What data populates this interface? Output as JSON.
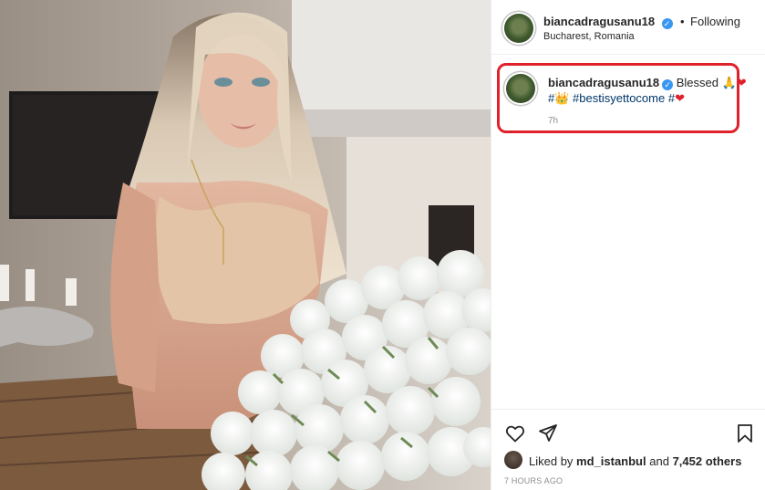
{
  "post": {
    "username": "biancadragusanu18",
    "follow_separator": "•",
    "follow_state": "Following",
    "location": "Bucharest, Romania"
  },
  "caption": {
    "username": "biancadragusanu18",
    "text": "Blessed",
    "emoji_pray": "🙏",
    "emoji_heart": "❤",
    "hash_1": "#",
    "emoji_crown": "👑",
    "hashtag": "#bestisyettocome",
    "hash_2": "#",
    "emoji_heart_2": "❤",
    "time": "7h"
  },
  "likes": {
    "prefix": "Liked by",
    "user": "md_istanbul",
    "joiner": "and",
    "count": "7,452 others"
  },
  "timestamp": "7 HOURS AGO",
  "colors": {
    "verified": "#3897f0",
    "highlight": "#e0202a",
    "hashtag": "#00376b"
  },
  "icons": [
    "heart-icon",
    "share-icon",
    "bookmark-icon",
    "verified-icon"
  ]
}
